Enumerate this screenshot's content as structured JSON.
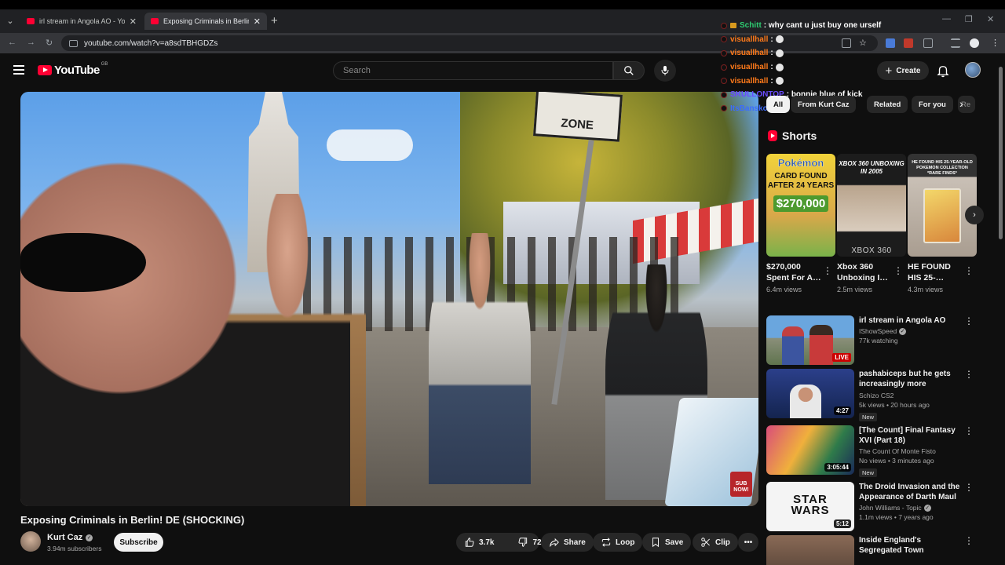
{
  "browser": {
    "tabs": [
      {
        "title": "irl stream in Angola AO - YouTube",
        "active": false
      },
      {
        "title": "Exposing Criminals in Berlin! DE",
        "active": true
      }
    ],
    "new_tab": "+",
    "url": "youtube.com/watch?v=a8sdTBHGDZs"
  },
  "header": {
    "logo_text": "YouTube",
    "country_code": "GB",
    "search_placeholder": "Search",
    "create_label": "Create"
  },
  "player": {
    "sign_text": "ZONE",
    "sub_badge": "SUB NOW!"
  },
  "video": {
    "title": "Exposing Criminals in Berlin! DE (SHOCKING)",
    "channel": "Kurt Caz",
    "subscribers": "3.94m subscribers",
    "subscribe_label": "Subscribe",
    "likes": "3.7k",
    "dislikes": "72",
    "share_label": "Share",
    "loop_label": "Loop",
    "save_label": "Save",
    "clip_label": "Clip"
  },
  "chat": [
    {
      "user": "Schitt",
      "msg": ": why cant u just buy one urself",
      "color": "#2ecc71",
      "badge": true,
      "emote": false
    },
    {
      "user": "visuallhall",
      "msg": ":",
      "color": "#ff7a1a",
      "badge": false,
      "emote": true
    },
    {
      "user": "visuallhall",
      "msg": ":",
      "color": "#ff7a1a",
      "badge": false,
      "emote": true
    },
    {
      "user": "visuallhall",
      "msg": ":",
      "color": "#ff7a1a",
      "badge": false,
      "emote": true
    },
    {
      "user": "visuallhall",
      "msg": ":",
      "color": "#ff7a1a",
      "badge": false,
      "emote": true
    },
    {
      "user": "SKULLONTOP",
      "msg": ": bonnie blue of kick",
      "color": "#6a4cff",
      "badge": false,
      "emote": false
    },
    {
      "user": "ItsBansko",
      "msg": "",
      "color": "#3b6cff",
      "badge": false,
      "emote": false
    }
  ],
  "chips": [
    "All",
    "From Kurt Caz",
    "Related",
    "For you",
    "Re"
  ],
  "shorts": {
    "heading": "Shorts",
    "items": [
      {
        "title": "$270,000 Spent For A…",
        "views": "6.4m views",
        "thumb": {
          "brand": "Pokémon",
          "text": "CARD FOUND AFTER 24 YEARS",
          "price": "$270,000"
        }
      },
      {
        "title": "Xbox 360 Unboxing I…",
        "views": "2.5m views",
        "thumb": {
          "heading": "XBOX 360 UNBOXING IN 2005",
          "footer": "XBOX 360"
        }
      },
      {
        "title": "HE FOUND HIS 25-…",
        "views": "4.3m views",
        "thumb": {
          "heading": "HE FOUND HIS 25-YEAR-OLD POKEMON COLLECTION *RARE FINDS*"
        }
      }
    ]
  },
  "recommendations": [
    {
      "title": "irl stream in Angola AO",
      "channel": "IShowSpeed",
      "verified": true,
      "info": "77k watching",
      "badge_overlay": "LIVE",
      "new": false
    },
    {
      "title": "pashabiceps but he gets increasingly more unhinged",
      "channel": "Schizo CS2",
      "verified": false,
      "info": "5k views • 20 hours ago",
      "badge_overlay": "4:27",
      "new": true
    },
    {
      "title": "[The Count] Final Fantasy XVI (Part 18)",
      "channel": "The Count Of Monte Fisto",
      "verified": false,
      "info": "No views • 3 minutes ago",
      "badge_overlay": "3:05:44",
      "new": true
    },
    {
      "title": "The Droid Invasion and the Appearance of Darth Maul",
      "channel": "John Williams - Topic",
      "verified": true,
      "info": "1.1m views • 7 years ago",
      "badge_overlay": "5:12",
      "new": false,
      "thumb_text": "STAR WARS"
    },
    {
      "title": "Inside England's Segregated Town (Blackburn)",
      "channel": "",
      "verified": false,
      "info": "",
      "badge_overlay": "",
      "new": false
    }
  ],
  "labels": {
    "new": "New"
  }
}
